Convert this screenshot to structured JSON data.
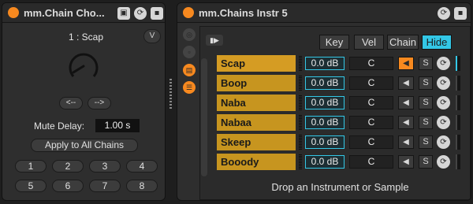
{
  "left_device": {
    "title": "mm.Chain Cho...",
    "chain_display": "1 : Scap",
    "v_button": "V",
    "prev_button": "<--",
    "next_button": "-->",
    "mute_delay_label": "Mute Delay:",
    "mute_delay_value": "1.00 s",
    "apply_button": "Apply to All Chains",
    "number_buttons": [
      "1",
      "2",
      "3",
      "4",
      "5",
      "6",
      "7",
      "8"
    ],
    "knob_level": 0.05
  },
  "right_device": {
    "title": "mm.Chains Instr 5",
    "tabs": [
      {
        "label": "Key",
        "active": false
      },
      {
        "label": "Vel",
        "active": false
      },
      {
        "label": "Chain",
        "active": false
      },
      {
        "label": "Hide",
        "active": true
      }
    ],
    "chains": [
      {
        "name": "Scap",
        "volume": "0.0 dB",
        "pan": "C",
        "solo": "S",
        "active": true
      },
      {
        "name": "Boop",
        "volume": "0.0 dB",
        "pan": "C",
        "solo": "S",
        "active": false
      },
      {
        "name": "Naba",
        "volume": "0.0 dB",
        "pan": "C",
        "solo": "S",
        "active": false
      },
      {
        "name": "Nabaa",
        "volume": "0.0 dB",
        "pan": "C",
        "solo": "S",
        "active": false
      },
      {
        "name": "Skeep",
        "volume": "0.0 dB",
        "pan": "C",
        "solo": "S",
        "active": false
      },
      {
        "name": "Booody",
        "volume": "0.0 dB",
        "pan": "C",
        "solo": "S",
        "active": false
      }
    ],
    "drop_hint": "Drop an Instrument or Sample"
  },
  "colors": {
    "accent_orange": "#f7891f",
    "accent_cyan": "#33c7e6",
    "chain_gold": "#c7951f"
  },
  "icons": [
    "power-icon",
    "pin-icon",
    "cycle-icon",
    "save-icon",
    "chain-selector-icon",
    "key-icon",
    "speaker-icon",
    "solo-icon"
  ]
}
